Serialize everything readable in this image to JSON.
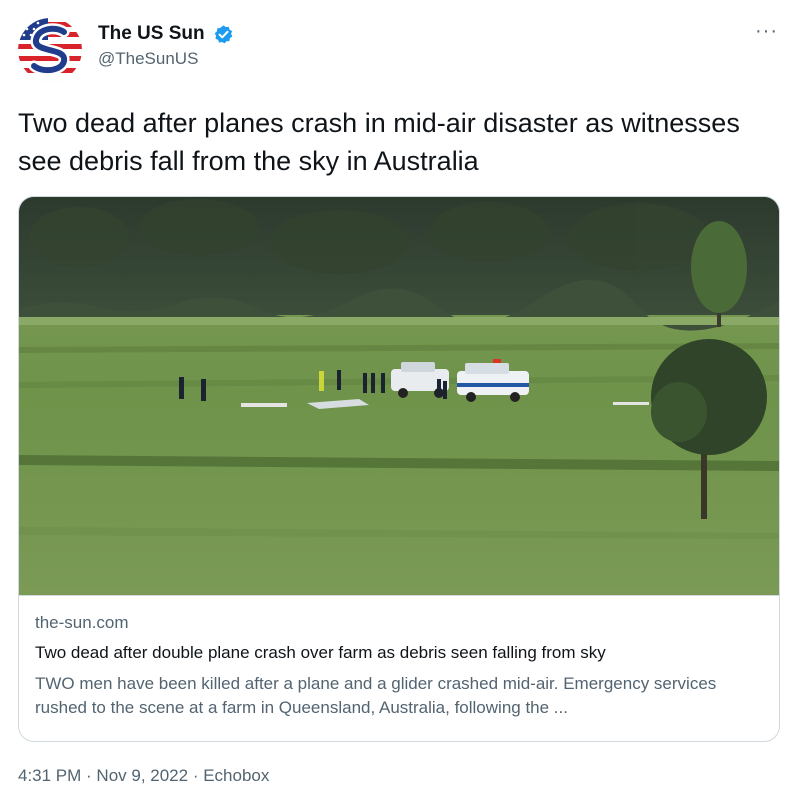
{
  "author": {
    "name": "The US Sun",
    "handle": "@TheSunUS",
    "verified": true,
    "avatar_icon": "the-sun-logo-icon"
  },
  "more_label": "···",
  "tweet": {
    "text": "Two dead after planes crash in mid-air disaster as witnesses see debris fall from the sky in Australia"
  },
  "card": {
    "image_icon": "crash-site-photo",
    "domain": "the-sun.com",
    "title": "Two dead after double plane crash over farm as debris seen falling from sky",
    "description": "TWO men have been killed after a plane and a glider crashed mid-air. Emergency services rushed to the scene at a farm in Queensland, Australia, following the ..."
  },
  "meta": {
    "time": "4:31 PM",
    "separator": " · ",
    "date": "Nov 9, 2022",
    "source": "Echobox"
  },
  "colors": {
    "text_primary": "#0f1419",
    "text_secondary": "#536471",
    "verified_blue": "#1d9bf0",
    "border": "#cfd9de"
  }
}
